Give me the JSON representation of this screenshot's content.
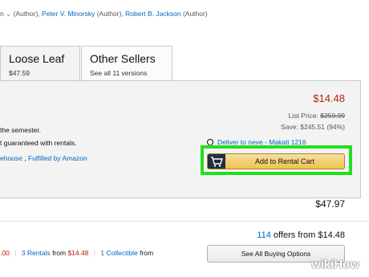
{
  "authors": {
    "prefix": "n",
    "sep1": " (Author), ",
    "author2": "Peter V. Minorsky",
    "sep2": " (Author), ",
    "author3": "Robert B. Jackson",
    "sep3": " (Author)"
  },
  "tabs": [
    {
      "title": "Loose Leaf",
      "subtitle": "$47.59"
    },
    {
      "title": "Other Sellers",
      "subtitle": "See all 11 versions"
    }
  ],
  "rental": {
    "price": "$14.48",
    "list_price_label": "List Price: ",
    "list_price": "$259.99",
    "save": "Save: $245.51 (94%)",
    "line1": "the semester.",
    "line2": "t guaranteed with rentals.",
    "seller_part": "ehouse",
    "sep": " , ",
    "fulfilled": "Fulfilled by Amazon",
    "deliver": "Deliver to neve - Makati 1216",
    "add_button": "Add to Rental Cart"
  },
  "buy_price": "$47.97",
  "offers": {
    "count": "114",
    "text": " offers from $14.48",
    "left_price": ".00",
    "rentals_link": "3 Rentals",
    "rentals_from": " from ",
    "rentals_price": "$14.48",
    "collectible_link": "1 Collectible",
    "collectible_from": " from",
    "see_all": "See All Buying Options"
  },
  "watermark": "wikiHow",
  "colors": {
    "highlight": "#22e01b",
    "price_red": "#b12704",
    "link": "#0066c0",
    "button": "#f0c14b"
  }
}
